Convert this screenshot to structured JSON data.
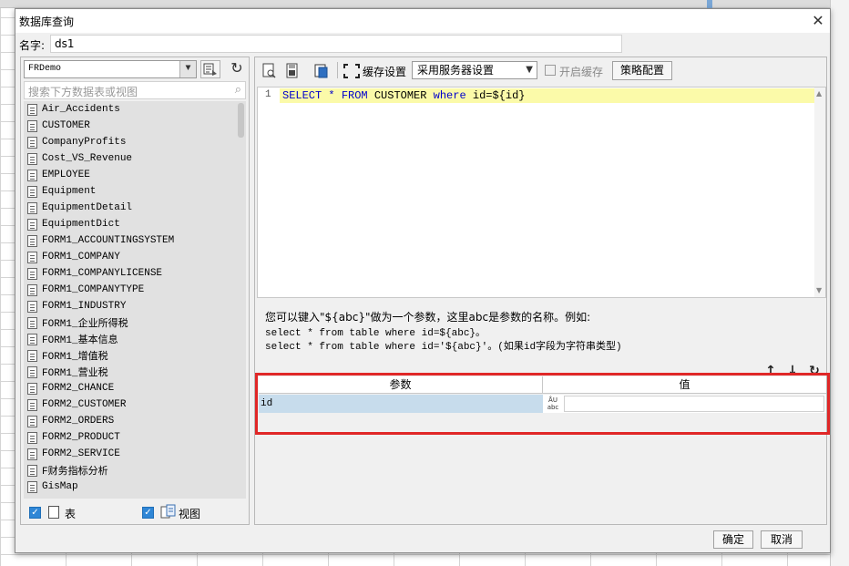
{
  "dialog": {
    "title": "数据库查询",
    "close_glyph": "✕"
  },
  "name_field": {
    "label": "名字:",
    "value": "ds1"
  },
  "left": {
    "db_select_value": "FRDemo",
    "search_placeholder": "搜索下方数据表或视图",
    "tables": [
      "Air_Accidents",
      "CUSTOMER",
      "CompanyProfits",
      "Cost_VS_Revenue",
      "EMPLOYEE",
      "Equipment",
      "EquipmentDetail",
      "EquipmentDict",
      "FORM1_ACCOUNTINGSYSTEM",
      "FORM1_COMPANY",
      "FORM1_COMPANYLICENSE",
      "FORM1_COMPANYTYPE",
      "FORM1_INDUSTRY",
      "FORM1_企业所得税",
      "FORM1_基本信息",
      "FORM1_增值税",
      "FORM1_营业税",
      "FORM2_CHANCE",
      "FORM2_CUSTOMER",
      "FORM2_ORDERS",
      "FORM2_PRODUCT",
      "FORM2_SERVICE",
      "F财务指标分析",
      "GisMap"
    ],
    "footer": {
      "table_label": "表",
      "view_label": "视图"
    }
  },
  "toolbar": {
    "cache_label": "缓存设置",
    "cache_select_value": "采用服务器设置",
    "enable_cache_label": "开启缓存",
    "policy_button": "策略配置"
  },
  "editor": {
    "line_number": "1",
    "sql": {
      "kw_select": "SELECT",
      "star": " * ",
      "kw_from": "FROM",
      "table": " CUSTOMER ",
      "kw_where": "where",
      "condition": " id=${id}"
    }
  },
  "hint": {
    "line1": "您可以键入\"${abc}\"做为一个参数，这里abc是参数的名称。例如:",
    "line2": "select * from table where id=${abc}。",
    "line3": "select * from table where id='${abc}'。(如果id字段为字符串类型)"
  },
  "params": {
    "header_param": "参数",
    "header_value": "值",
    "rows": [
      {
        "name": "id",
        "type_glyph": "ÅU abc",
        "value": ""
      }
    ]
  },
  "buttons": {
    "ok": "确定",
    "cancel": "取消"
  }
}
